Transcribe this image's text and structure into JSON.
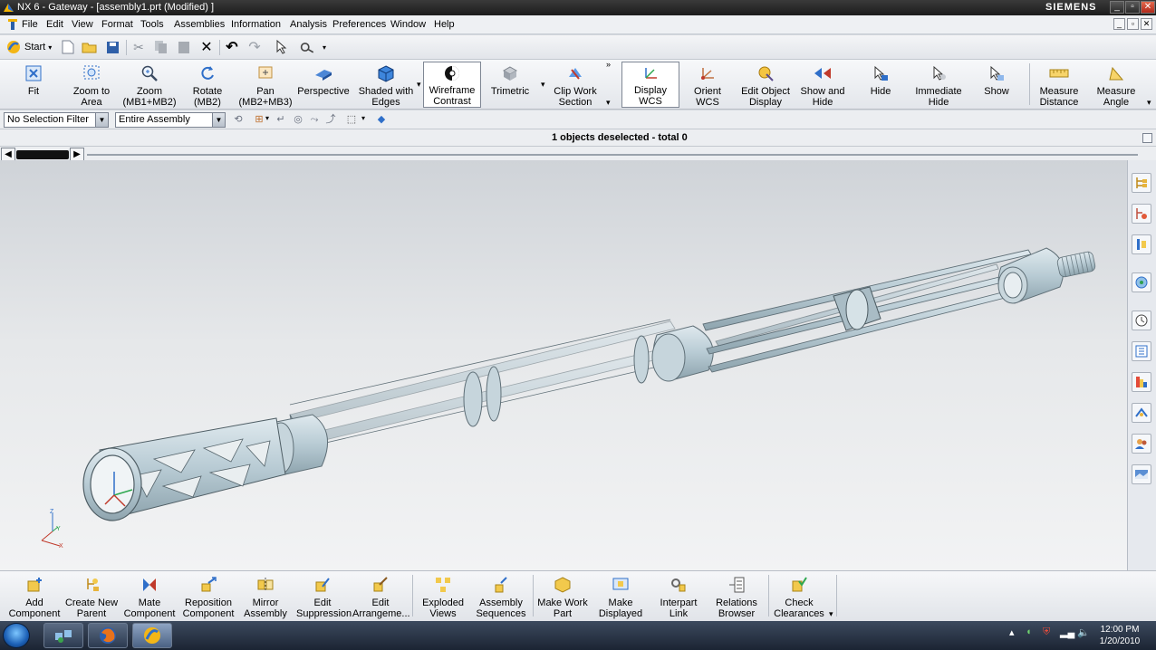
{
  "window": {
    "title": "NX 6 - Gateway - [assembly1.prt (Modified) ]",
    "brand": "SIEMENS",
    "controls": [
      "_",
      "▫",
      "✕"
    ]
  },
  "menu": {
    "items": [
      "File",
      "Edit",
      "View",
      "Format",
      "Tools",
      "Assemblies",
      "Information",
      "Analysis",
      "Preferences",
      "Window",
      "Help"
    ]
  },
  "standard_toolbar": {
    "start_label": "Start"
  },
  "view_toolbar": {
    "buttons": [
      {
        "label": "Fit",
        "icon": "fit-icon"
      },
      {
        "label": "Zoom to Area",
        "icon": "zoom-area-icon"
      },
      {
        "label": "Zoom (MB1+MB2)",
        "icon": "zoom-icon"
      },
      {
        "label": "Rotate (MB2)",
        "icon": "rotate-icon"
      },
      {
        "label": "Pan (MB2+MB3)",
        "icon": "pan-icon"
      },
      {
        "label": "Perspective",
        "icon": "perspective-icon"
      },
      {
        "label": "Shaded with Edges",
        "icon": "shaded-edges-icon"
      },
      {
        "label": "Wireframe Contrast",
        "icon": "wireframe-contrast-icon"
      },
      {
        "label": "Trimetric",
        "icon": "trimetric-icon"
      },
      {
        "label": "Clip Work Section",
        "icon": "clip-section-icon"
      },
      {
        "label": "Display WCS",
        "icon": "display-wcs-icon"
      },
      {
        "label": "Orient WCS",
        "icon": "orient-wcs-icon"
      },
      {
        "label": "Edit Object Display",
        "icon": "edit-object-display-icon"
      },
      {
        "label": "Show and Hide",
        "icon": "show-and-hide-icon"
      },
      {
        "label": "Hide",
        "icon": "hide-icon"
      },
      {
        "label": "Immediate Hide",
        "icon": "immediate-hide-icon"
      },
      {
        "label": "Show",
        "icon": "show-icon"
      },
      {
        "label": "Measure Distance",
        "icon": "measure-distance-icon"
      },
      {
        "label": "Measure Angle",
        "icon": "measure-angle-icon"
      }
    ]
  },
  "selection_bar": {
    "filter_value": "No Selection Filter",
    "scope_value": "Entire Assembly"
  },
  "status": {
    "message": "1 objects deselected  - total 0"
  },
  "assemblies_toolbar": {
    "buttons": [
      {
        "label": "Add Component",
        "icon": "add-component-icon"
      },
      {
        "label": "Create New Parent",
        "icon": "create-new-parent-icon"
      },
      {
        "label": "Mate Component",
        "icon": "mate-component-icon"
      },
      {
        "label": "Reposition Component",
        "icon": "reposition-component-icon"
      },
      {
        "label": "Mirror Assembly",
        "icon": "mirror-assembly-icon"
      },
      {
        "label": "Edit Suppression",
        "icon": "edit-suppression-icon"
      },
      {
        "label": "Edit Arrangeme...",
        "icon": "edit-arrangement-icon"
      },
      {
        "label": "Exploded Views",
        "icon": "exploded-views-icon"
      },
      {
        "label": "Assembly Sequences",
        "icon": "assembly-sequences-icon"
      },
      {
        "label": "Make Work Part",
        "icon": "make-work-part-icon"
      },
      {
        "label": "Make Displayed",
        "icon": "make-displayed-icon"
      },
      {
        "label": "Interpart Link",
        "icon": "interpart-link-icon"
      },
      {
        "label": "Relations Browser",
        "icon": "relations-browser-icon"
      },
      {
        "label": "Check Clearances",
        "icon": "check-clearances-icon"
      }
    ]
  },
  "triad": {
    "x": "X",
    "y": "Y",
    "z": "Z"
  },
  "taskbar": {
    "time": "12:00 PM",
    "date": "1/20/2010"
  },
  "colors": {
    "model_fill": "#b8cbd4",
    "model_edge": "#5f6f77",
    "accent_blue": "#2f6fc9"
  }
}
